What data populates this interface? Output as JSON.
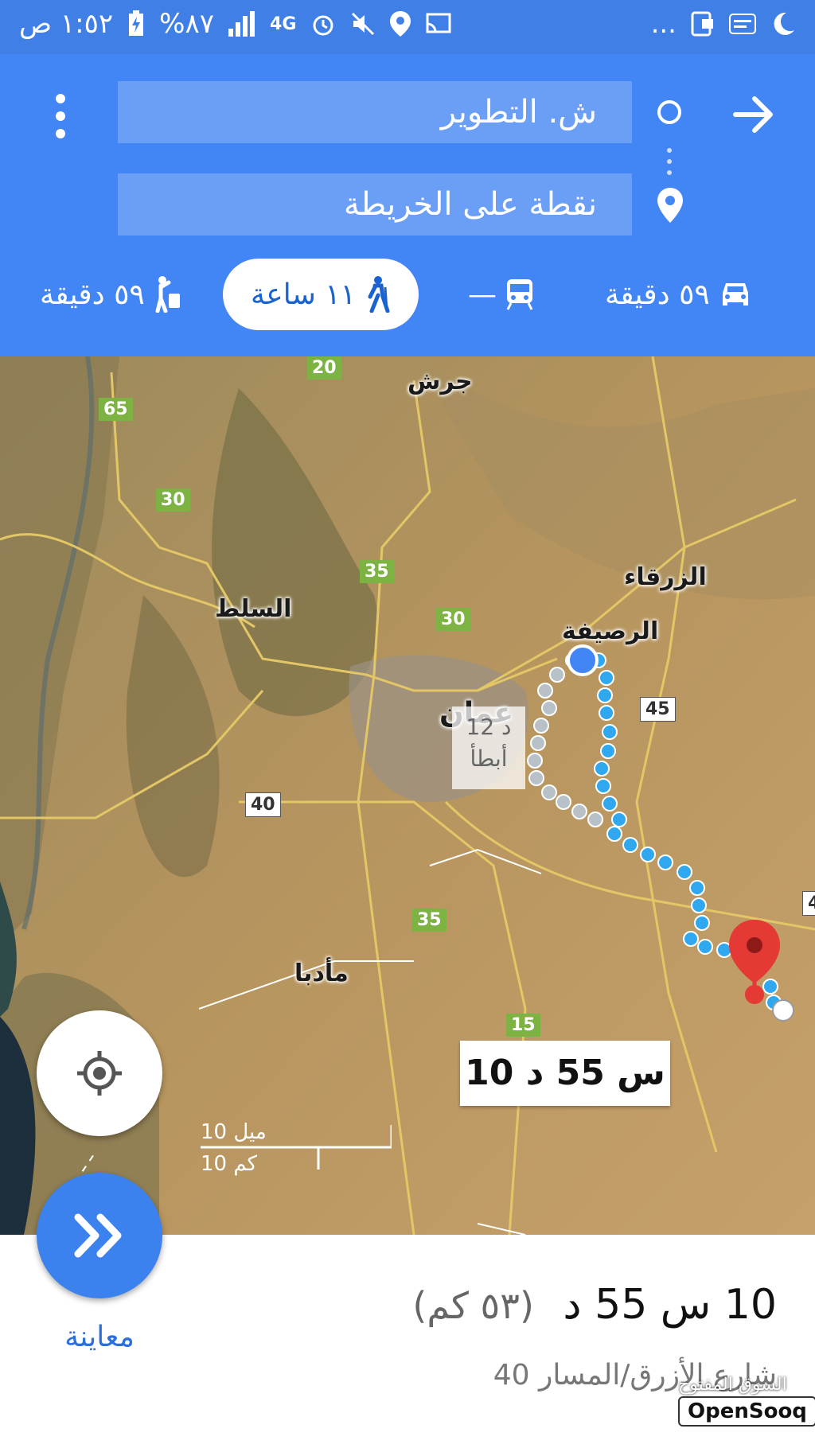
{
  "status_bar": {
    "time": "١:٥٢ ص",
    "battery": "%٨٧",
    "network": "4G",
    "more": "...",
    "icons": [
      "moon-icon",
      "opensooq-app-icon",
      "screenshot-icon",
      "cast-icon",
      "location-icon",
      "mute-icon",
      "alarm-icon",
      "signal-icon",
      "battery-icon"
    ]
  },
  "directions": {
    "origin": "ش. التطوير",
    "destination": "نقطة على الخريطة"
  },
  "modes": {
    "drive": "٥٩ دقيقة",
    "transit": "—",
    "walk": "١١ ساعة",
    "ride": "٥٩ دقيقة",
    "selected": "walk"
  },
  "map": {
    "cities": {
      "jerash": "جرش",
      "zarqa": "الزرقاء",
      "salt": "السلط",
      "russeifa": "الرصيفة",
      "amman": "عمان",
      "madaba": "مأدبا"
    },
    "route_numbers": [
      "20",
      "65",
      "30",
      "35",
      "30",
      "45",
      "40",
      "35",
      "15",
      "4"
    ],
    "alt_route": {
      "time": "12 د",
      "note": "أبطأ"
    },
    "route_time": "10 س 55 د",
    "scale_miles": "10 ميل",
    "scale_km": "10 كم",
    "colors": {
      "route": "#2fa8ef",
      "alt_route": "#b8c0c8",
      "pin": "#e53935"
    }
  },
  "summary": {
    "duration": "10 س 55 د",
    "distance": "(٥٣ كم)",
    "via": "شارع الأزرق/المسار 40"
  },
  "preview": {
    "label": "معاينة"
  },
  "watermark": {
    "arabic": "السوق المفتوح",
    "brand": "OpenSooq"
  }
}
